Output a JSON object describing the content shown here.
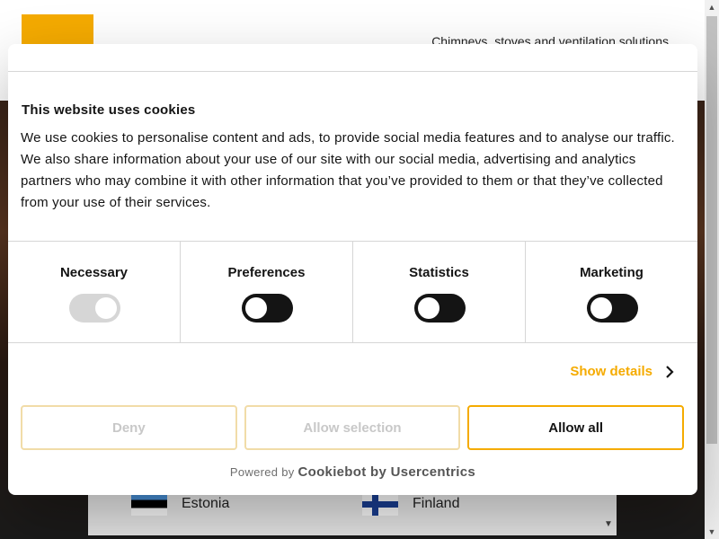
{
  "background": {
    "tagline": "Chimneys, stoves and ventilation solutions",
    "countries": [
      {
        "name": "Estonia",
        "flag": "estonia-flag"
      },
      {
        "name": "Finland",
        "flag": "finland-flag"
      }
    ]
  },
  "cookie_dialog": {
    "title": "This website uses cookies",
    "body": "We use cookies to personalise content and ads, to provide social media features and to analyse our traffic. We also share information about your use of our site with our social media, advertising and analytics partners who may combine it with other information that you’ve provided to them or that they’ve collected from your use of their services.",
    "categories": [
      {
        "label": "Necessary",
        "enabled": true,
        "disabled": true
      },
      {
        "label": "Preferences",
        "enabled": false,
        "disabled": false
      },
      {
        "label": "Statistics",
        "enabled": false,
        "disabled": false
      },
      {
        "label": "Marketing",
        "enabled": false,
        "disabled": false
      }
    ],
    "show_details": "Show details",
    "buttons": {
      "deny": "Deny",
      "allow_selection": "Allow selection",
      "allow_all": "Allow all"
    },
    "powered_by_prefix": "Powered by",
    "powered_by_brand": "Cookiebot by Usercentrics"
  },
  "colors": {
    "accent": "#f5ab00",
    "text": "#141414",
    "toggle_off": "#141414",
    "toggle_disabled": "#d6d6d6"
  }
}
